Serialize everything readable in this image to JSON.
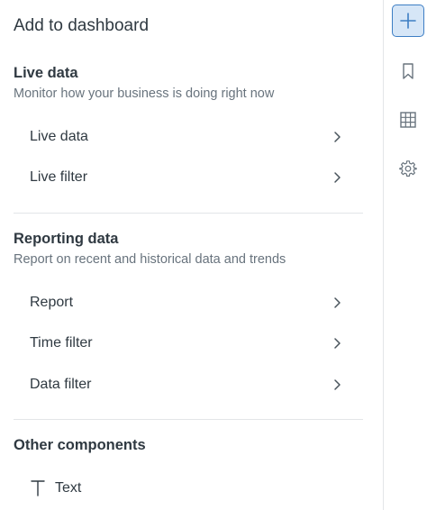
{
  "panel": {
    "title": "Add to dashboard"
  },
  "sections": [
    {
      "title": "Live data",
      "description": "Monitor how your business is doing right now",
      "items": [
        {
          "label": "Live data"
        },
        {
          "label": "Live filter"
        }
      ]
    },
    {
      "title": "Reporting data",
      "description": "Report on recent and historical data and trends",
      "items": [
        {
          "label": "Report"
        },
        {
          "label": "Time filter"
        },
        {
          "label": "Data filter"
        }
      ]
    },
    {
      "title": "Other components",
      "items": [
        {
          "label": "Text",
          "icon": "text-icon"
        }
      ]
    }
  ],
  "rail": {
    "buttons": [
      {
        "icon": "plus-icon",
        "active": true
      },
      {
        "icon": "bookmark-icon",
        "active": false
      },
      {
        "icon": "table-icon",
        "active": false
      },
      {
        "icon": "gear-icon",
        "active": false
      }
    ]
  },
  "colors": {
    "accent": "#3d7ec4",
    "accent_bg": "#d6e6f7",
    "text": "#2f3941",
    "muted": "#68737d",
    "divider": "#e3e5e8"
  }
}
